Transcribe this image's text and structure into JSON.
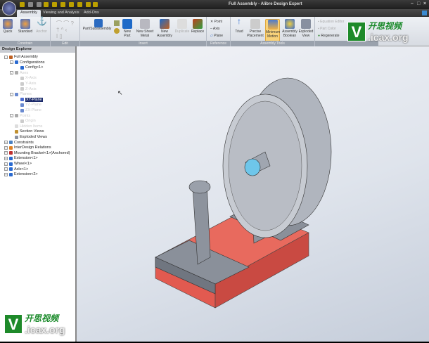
{
  "app": {
    "title": "Full Assembly - Alibre Design Expert"
  },
  "tabs": [
    "Assembly",
    "Viewing and Analysis",
    "Add-Ons"
  ],
  "ribbon": {
    "groups": [
      "Constrain",
      "Edit",
      "Insert",
      "Reference",
      "Assembly Tools"
    ],
    "constrain": [
      "Quick",
      "Standard",
      "Anchor"
    ],
    "insert": [
      "Part/Subassembly",
      "New Part",
      "New Sheet Metal",
      "New Assembly",
      "Duplicate",
      "Replace"
    ],
    "reference": [
      "Point",
      "Axis",
      "Plane"
    ],
    "tools": [
      "Triad",
      "Precise Placement",
      "Minimum Motion",
      "Assembly Boolean",
      "Exploded View"
    ],
    "side": [
      "Equation Editor",
      "Part Color",
      "Regenerate"
    ]
  },
  "explorer": {
    "title": "Design Explorer",
    "nodes": [
      "Full Assembly",
      "Configurations",
      "Config<1>",
      "Axes",
      "X-Axis",
      "Y-Axis",
      "Z-Axis",
      "Planes",
      "XY-Plane",
      "YZ-Plane",
      "ZX-Plane",
      "Points",
      "Origin",
      "Hidden Items",
      "Section Views",
      "Exploded Views",
      "Constraints",
      "InterDesign Relations",
      "Mounting Bracket<1>(Anchored)",
      "Extension<1>",
      "Wheel<1>",
      "Axle<1>",
      "Extension<2>"
    ]
  },
  "watermark": {
    "cn": "开思视频",
    "url": ".icax.org",
    "letter": "V"
  }
}
